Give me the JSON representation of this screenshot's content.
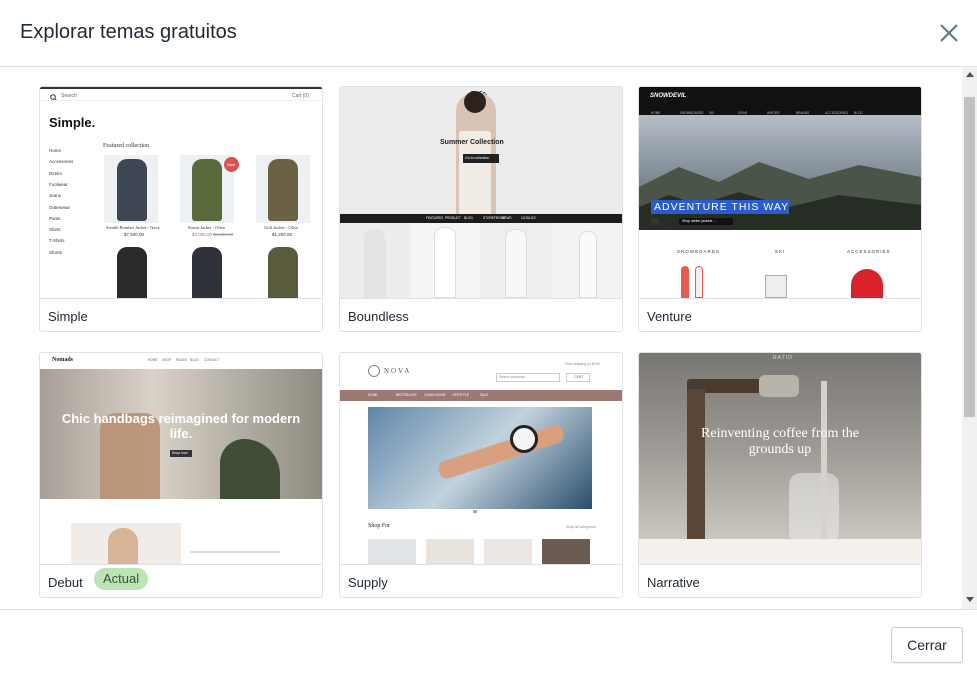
{
  "modal": {
    "title": "Explorar temas gratuitos",
    "close_button": "Cerrar"
  },
  "themes": [
    {
      "name": "Simple"
    },
    {
      "name": "Boundless"
    },
    {
      "name": "Venture"
    },
    {
      "name": "Debut",
      "badge": "Actual"
    },
    {
      "name": "Supply"
    },
    {
      "name": "Narrative"
    }
  ],
  "previews": {
    "simple": {
      "search": "Search",
      "cart": "Cart (0)",
      "logo": "Simple.",
      "featured": "Featured collection",
      "nav": [
        "Home",
        "Accessories",
        "Denim",
        "Footwear",
        "Jeans",
        "Outerwear",
        "Pants",
        "Shirts",
        "T-Shirts",
        "Shorts"
      ],
      "products": [
        {
          "title": "Stealth Bomber Jacket - Navy",
          "price": "$7,500.00"
        },
        {
          "title": "Storm Jacket - Olive",
          "price": "$4,000.00",
          "old": "$8,000.00"
        },
        {
          "title": "Golf Jacket - Olive",
          "price": "$1,200.00"
        }
      ],
      "sale": "Sale"
    },
    "boundless": {
      "logo": "Re-Co.",
      "heading": "Summer Collection",
      "button": "Go to collection",
      "nav": [
        "FEATURED",
        "PRODUCT",
        "BLOG",
        "STOREFRONT",
        "NEWS",
        "CATALOG"
      ]
    },
    "venture": {
      "logo": "SNOWDEVIL",
      "nav": [
        "HOME",
        "SNOWBOARDS",
        "SKI",
        "GEAR",
        "WINTER",
        "BRANDS",
        "ACCESSORIES",
        "BLOG"
      ],
      "hero": "ADVENTURE THIS WAY",
      "cta": "Shop winter jackets →",
      "cats": [
        "SNOWBOARDS",
        "SKI",
        "ACCESSORIES"
      ],
      "sub": "View all"
    },
    "debut": {
      "logo": "Nomads",
      "nav": [
        "HOME",
        "SHOP",
        "PAGES",
        "BLOG",
        "CONTACT"
      ],
      "hero": "Chic handbags reimagined for modern life.",
      "button": "Shop now"
    },
    "supply": {
      "logo": "NOVA",
      "search": "Search products...",
      "cart": "CART",
      "nav": [
        "HOME",
        "BESTSELLER",
        "LIVING ROOM",
        "LIFESTYLE",
        "SALE"
      ],
      "section": "Shop For",
      "link": "Shop all categories",
      "top": "Free shipping on $100"
    },
    "narrative": {
      "logo": "RATIO",
      "hero": "Reinventing coffee from the grounds up"
    }
  }
}
